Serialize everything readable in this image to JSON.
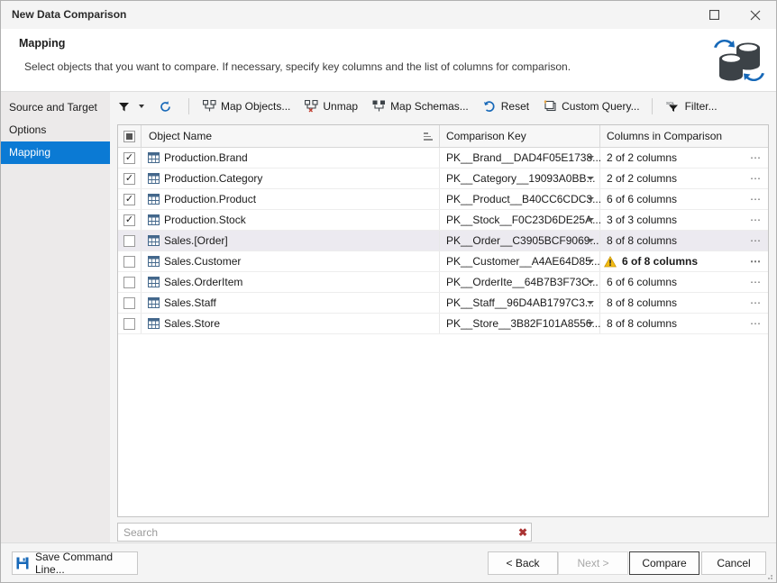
{
  "window": {
    "title": "New Data Comparison",
    "maximize_icon": "maximize-icon",
    "close_icon": "close-icon"
  },
  "header": {
    "title": "Mapping",
    "subtitle": "Select objects that you want to compare. If necessary, specify key columns and the list of columns for comparison.",
    "logo_icon": "database-sync-logo"
  },
  "sidebar": {
    "items": [
      {
        "label": "Source and Target",
        "selected": false
      },
      {
        "label": "Options",
        "selected": false
      },
      {
        "label": "Mapping",
        "selected": true
      }
    ],
    "selected_color": "#0b7ad4"
  },
  "toolbar": {
    "items": [
      {
        "label": "",
        "icon": "filter-funnel-icon",
        "has_caret": true
      },
      {
        "label": "",
        "icon": "refresh-icon",
        "has_caret": false
      },
      {
        "label": "Map Objects...",
        "icon": "map-objects-icon",
        "has_caret": false
      },
      {
        "label": "Unmap",
        "icon": "unmap-icon",
        "has_caret": false
      },
      {
        "label": "Map Schemas...",
        "icon": "map-schemas-icon",
        "has_caret": false
      },
      {
        "label": "Reset",
        "icon": "reset-icon",
        "has_caret": false
      },
      {
        "label": "Custom Query...",
        "icon": "custom-query-icon",
        "has_caret": false
      },
      {
        "label": "Filter...",
        "icon": "sql-filter-icon",
        "has_caret": false
      }
    ]
  },
  "grid": {
    "columns": [
      "",
      "Object Name",
      "Comparison Key",
      "Columns in Comparison"
    ],
    "select_all_state": "indeterminate",
    "sort_indicator": "ascending",
    "rows": [
      {
        "checked": true,
        "object": "Production.Brand",
        "key": "PK__Brand__DAD4F05E1738...",
        "columns": "2 of 2 columns",
        "warning": false,
        "highlighted": false
      },
      {
        "checked": true,
        "object": "Production.Category",
        "key": "PK__Category__19093A0BB...",
        "columns": "2 of 2 columns",
        "warning": false,
        "highlighted": false
      },
      {
        "checked": true,
        "object": "Production.Product",
        "key": "PK__Product__B40CC6CDC3...",
        "columns": "6 of 6 columns",
        "warning": false,
        "highlighted": false
      },
      {
        "checked": true,
        "object": "Production.Stock",
        "key": "PK__Stock__F0C23D6DE25A...",
        "columns": "3 of 3 columns",
        "warning": false,
        "highlighted": false
      },
      {
        "checked": false,
        "object": "Sales.[Order]",
        "key": "PK__Order__C3905BCF9069...",
        "columns": "8 of 8 columns",
        "warning": false,
        "highlighted": true
      },
      {
        "checked": false,
        "object": "Sales.Customer",
        "key": "PK__Customer__A4AE64D85...",
        "columns": "6 of 8 columns",
        "warning": true,
        "highlighted": false
      },
      {
        "checked": false,
        "object": "Sales.OrderItem",
        "key": "PK__OrderIte__64B7B3F73C...",
        "columns": "6 of 6 columns",
        "warning": false,
        "highlighted": false
      },
      {
        "checked": false,
        "object": "Sales.Staff",
        "key": "PK__Staff__96D4AB1797C3...",
        "columns": "8 of 8 columns",
        "warning": false,
        "highlighted": false
      },
      {
        "checked": false,
        "object": "Sales.Store",
        "key": "PK__Store__3B82F101A8556...",
        "columns": "8 of 8 columns",
        "warning": false,
        "highlighted": false
      }
    ],
    "row_icon": "table-grid-icon",
    "dropdown_icon": "chevron-down-icon",
    "more_icon": "ellipsis-icon",
    "warning_icon": "warning-triangle-icon",
    "warning_color": "#f5bc11"
  },
  "search": {
    "placeholder": "Search",
    "value": "",
    "clear_icon": "clear-x-icon",
    "clear_glyph": "✖"
  },
  "footer": {
    "save_command_line": "Save Command Line...",
    "save_icon": "save-floppy-icon",
    "back": "< Back",
    "next": "Next >",
    "compare": "Compare",
    "cancel": "Cancel",
    "next_disabled": true,
    "default_button": "Compare"
  }
}
